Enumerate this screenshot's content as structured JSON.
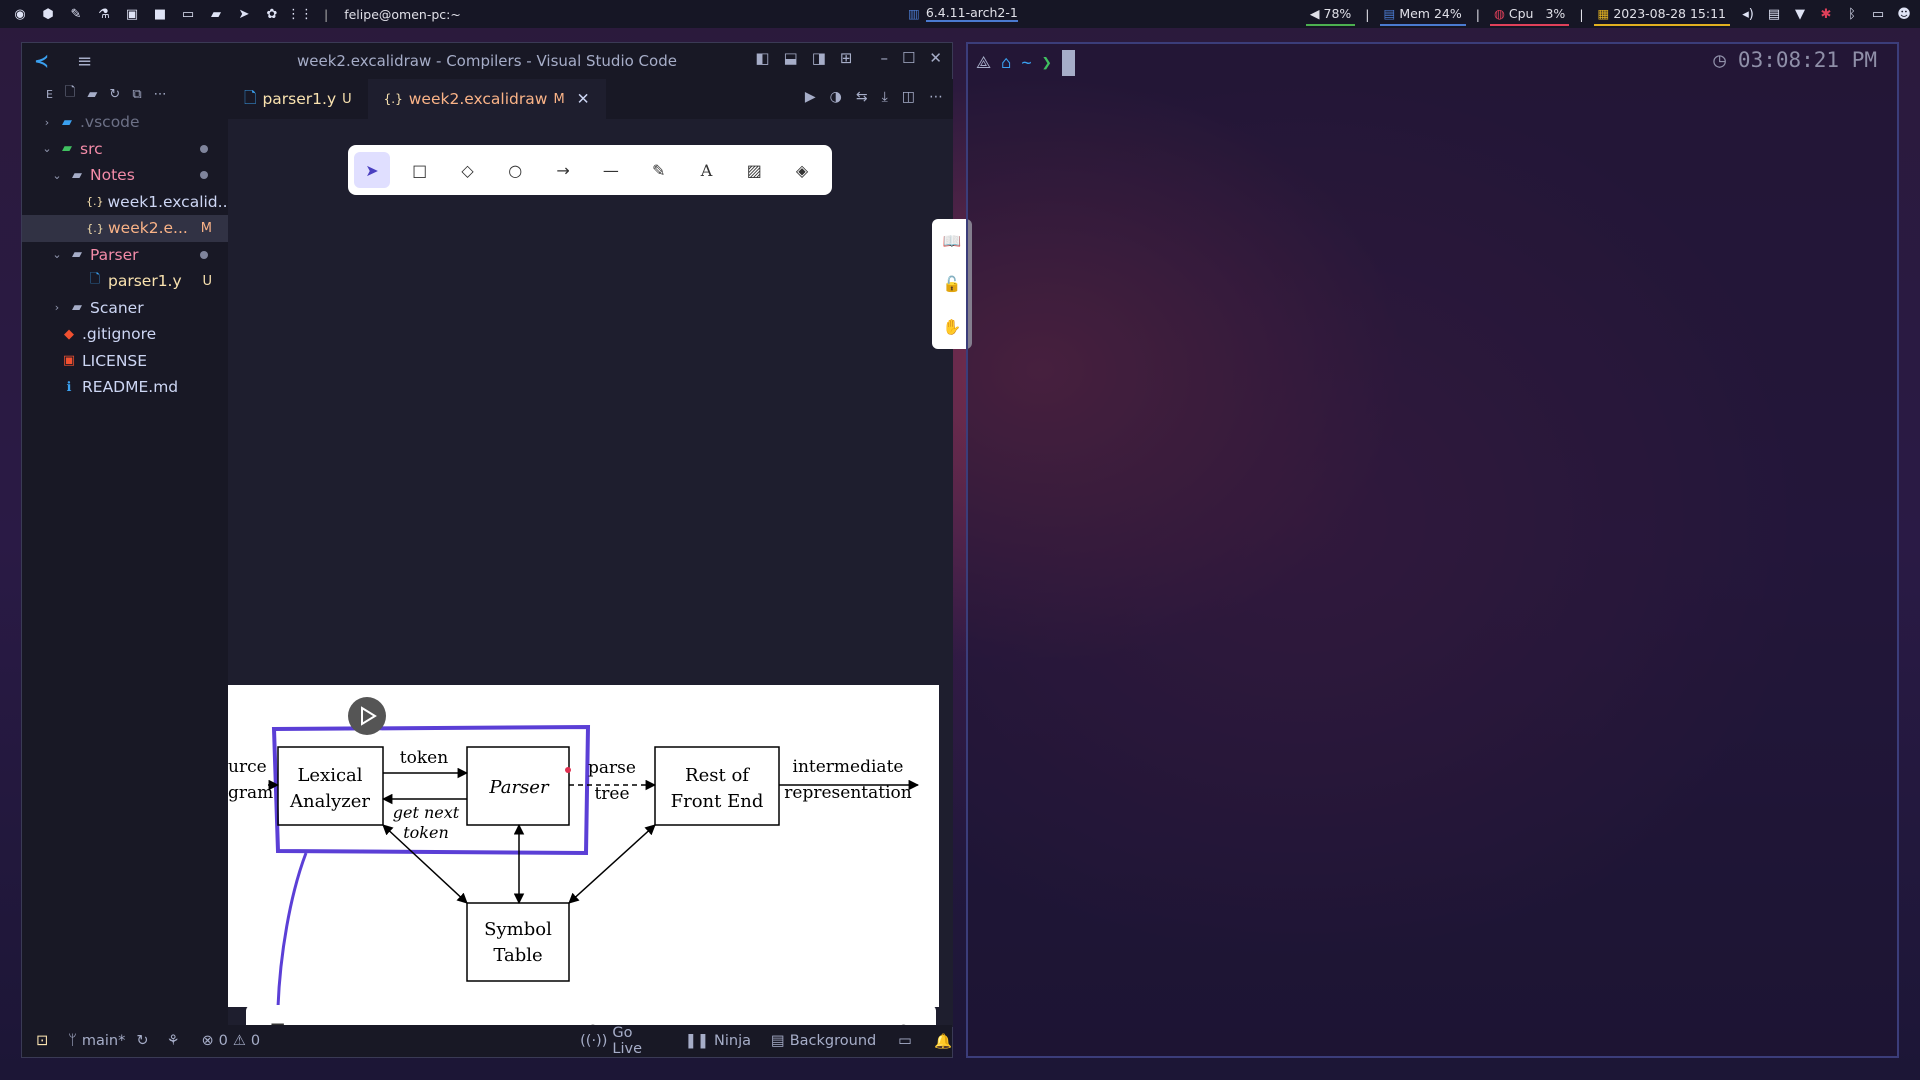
{
  "topbar": {
    "user_host": "felipe@omen-pc:~",
    "kernel": "6.4.11-arch2-1",
    "volume": "78%",
    "mem": "Mem 24%",
    "cpu_label": "Cpu",
    "cpu_value": "3%",
    "datetime": "2023-08-28 15:11",
    "separator": "|"
  },
  "vscode": {
    "window_title": "week2.excalidraw - Compilers - Visual Studio Code",
    "explorer_label": "E",
    "tree": [
      {
        "label": ".vscode",
        "color": "#6c7086"
      },
      {
        "label": "src",
        "color": "#f38ba8"
      },
      {
        "label": "Notes",
        "color": "#f38ba8"
      },
      {
        "label": "week1.excalid...",
        "color": "#cdd6f4"
      },
      {
        "label": "week2.e...",
        "color": "#fab387",
        "badge": "M"
      },
      {
        "label": "Parser",
        "color": "#f38ba8"
      },
      {
        "label": "parser1.y",
        "color": "#f9e2af",
        "badge": "U"
      },
      {
        "label": "Scaner",
        "color": "#cdd6f4"
      },
      {
        "label": ".gitignore",
        "color": "#cdd6f4"
      },
      {
        "label": "LICENSE",
        "color": "#cdd6f4"
      },
      {
        "label": "README.md",
        "color": "#cdd6f4"
      }
    ],
    "tabs": [
      {
        "label": "parser1.y",
        "badge": "U"
      },
      {
        "label": "week2.excalidraw",
        "badge": "M"
      }
    ],
    "status": {
      "branch": "main*",
      "errors": "0",
      "warnings": "0",
      "go_live": "Go Live",
      "ninja": "Ninja",
      "background": "Background"
    }
  },
  "diagram": {
    "left_text_1": "urce",
    "left_text_2": "gram",
    "lexical": "Lexical",
    "analyzer": "Analyzer",
    "token": "token",
    "parser": "Parser",
    "get_next": "get next",
    "token2": "token",
    "parse": "parse",
    "tree": "tree",
    "rest_of": "Rest of",
    "front_end": "Front End",
    "intermediate": "intermediate",
    "representation": "representation",
    "symbol": "Symbol",
    "table": "Table"
  },
  "terminal": {
    "home_symbol": "~",
    "prompt_symbol": "❯",
    "clock": "03:08:21 PM"
  },
  "colors": {
    "accent_blue": "#4a7ad0",
    "highlight_purple": "#5b3fd6"
  }
}
